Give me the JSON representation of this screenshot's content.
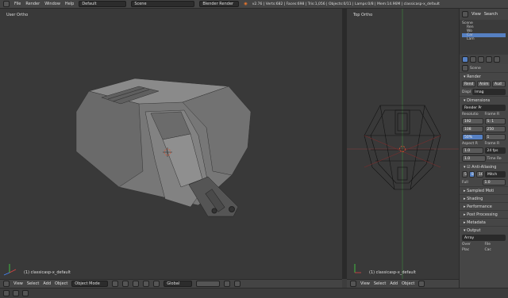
{
  "topbar": {
    "menus": [
      "File",
      "Render",
      "Window",
      "Help"
    ],
    "layout": "Default",
    "scene": "Scene",
    "engine": "Blender Render",
    "stats": "v2.76 | Verts:682 | Faces:698 | Tris:1,056 | Objects:0/11 | Lamps:0/8 | Mem:14.96M | classicasp-x_default"
  },
  "left_viewport": {
    "view_label": "User Ortho",
    "object_label": "(1) classicasp-x_default"
  },
  "right_viewport": {
    "view_label": "Top Ortho",
    "object_label": "(1) classicasp-x_default"
  },
  "left_header": {
    "menus": [
      "View",
      "Select",
      "Add",
      "Object"
    ],
    "mode": "Object Mode",
    "orientation": "Global"
  },
  "right_header": {
    "menus": [
      "View",
      "Select",
      "Add",
      "Object"
    ]
  },
  "outliner": {
    "tabs": [
      "View",
      "Search"
    ],
    "items": [
      "Scene",
      "Ren",
      "Wo",
      "Car",
      "Lam"
    ]
  },
  "properties": {
    "scene_label": "Scene",
    "render_section": "Render",
    "render_buttons": [
      "Rend",
      "Anim",
      "Aud"
    ],
    "display_label": "Displ",
    "display_value": "Imag",
    "dimensions_section": "Dimensions",
    "preset": "Render Pr",
    "resolution_label": "Resolutio",
    "frame_range_label": "Frame R",
    "res_x": "192",
    "res_y": "108",
    "res_pct": "50%",
    "frame_start": "S: 1",
    "frame_end": "250",
    "frame_step": "1",
    "aspect_label": "Aspect R",
    "frame_rate_label": "Frame R",
    "aspect_x": "1.0",
    "aspect_y": "1.0",
    "fps": "24 fps",
    "time_label": "Time Re",
    "anti_aliasing_section": "Anti-Aliasing",
    "aa_samples": [
      "5",
      "8",
      "16"
    ],
    "aa_filter": "Mitch",
    "full_label": "Full",
    "full_value": "1.0",
    "sections": [
      "Sampled Moti",
      "Shading",
      "Performance",
      "Post Processing",
      "Metadata",
      "Output"
    ],
    "output_value": "Array",
    "overwrite_label": "Over",
    "file_label": "File",
    "placeholders_label": "Plac",
    "cache_label": "Cac"
  }
}
